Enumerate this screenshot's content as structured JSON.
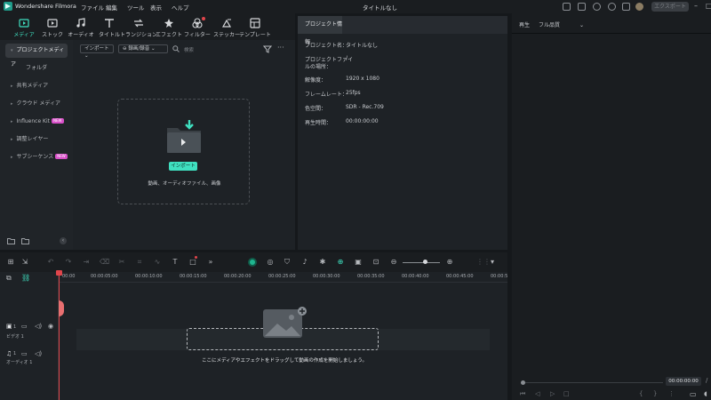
{
  "titlebar": {
    "app_name": "Wondershare Filmora",
    "menus": [
      "ファイル",
      "編集",
      "ツール",
      "表示",
      "ヘルプ"
    ],
    "doc_title": "タイトルなし",
    "export_label": "エクスポート"
  },
  "toolbar": {
    "tools": [
      {
        "label": "メディア",
        "icon": "media-icon",
        "active": true
      },
      {
        "label": "ストック",
        "icon": "stock-icon"
      },
      {
        "label": "オーディオ",
        "icon": "music-icon"
      },
      {
        "label": "タイトル",
        "icon": "title-icon"
      },
      {
        "label": "トランジション",
        "icon": "transition-icon"
      },
      {
        "label": "エフェクト",
        "icon": "effect-icon"
      },
      {
        "label": "フィルター",
        "icon": "filter-icon"
      },
      {
        "label": "ステッカー",
        "icon": "sticker-icon"
      },
      {
        "label": "テンプレート",
        "icon": "template-icon"
      }
    ]
  },
  "sidebar": {
    "items": [
      {
        "label": "プロジェクトメディア",
        "active": true
      },
      {
        "label": "フォルダ"
      },
      {
        "label": "共有メディア"
      },
      {
        "label": "クラウド メディア"
      },
      {
        "label": "Influence Kit",
        "badge": "NEW"
      },
      {
        "label": "調整レイヤー"
      },
      {
        "label": "サブシーケンス",
        "badge": "NEW"
      }
    ]
  },
  "media": {
    "import_dropdown": "インポート",
    "sort_dropdown": "録画/録音",
    "search_placeholder": "検索",
    "import_button": "インポート",
    "import_hint": "動画、オーディオファイル、画像"
  },
  "project_info": {
    "tab": "プロジェクト情報",
    "rows": [
      {
        "label": "プロジェクト名：",
        "value": "タイトルなし"
      },
      {
        "label": "プロジェクトファイ",
        "label2": "ルの場所：",
        "value": "/"
      },
      {
        "label": "解像度：",
        "value": "1920 x 1080"
      },
      {
        "label": "フレームレート：",
        "value": "25fps"
      },
      {
        "label": "色空間：",
        "value": "SDR - Rec.709"
      },
      {
        "label": "再生時間：",
        "value": "00:00:00:00"
      }
    ]
  },
  "preview": {
    "tab": "再生",
    "quality": "フル品質",
    "time": "00:00:00:00"
  },
  "timeline": {
    "ticks": [
      "00:00",
      "00:00:05:00",
      "00:00:10:00",
      "00:00:15:00",
      "00:00:20:00",
      "00:00:25:00",
      "00:00:30:00",
      "00:00:35:00",
      "00:00:40:00",
      "00:00:45:00",
      "00:00:5"
    ],
    "tracks": [
      {
        "label": "ビデオ 1",
        "num": "1"
      },
      {
        "label": "オーディオ 1",
        "num": "1"
      }
    ],
    "drop_hint": "ここにメディアやエフェクトをドラッグして動画の作成を開始しましょう。"
  },
  "colors": {
    "accent": "#3fe0c0",
    "playhead": "#e0454b",
    "new_badge": "#d84fc8"
  }
}
